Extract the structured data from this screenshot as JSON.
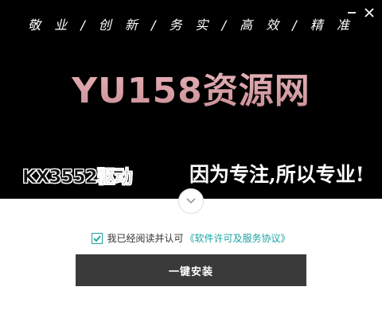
{
  "header": {
    "slogan": "敬 业 / 创 新 / 务 实 / 高 效 / 精 准",
    "minimize_icon": "minimize-icon",
    "close_icon": "close-icon"
  },
  "banner": {
    "brand": "YU158资源网",
    "product": "KX3552驱动",
    "tagline": "因为专注,所以专业!",
    "expand_icon": "chevron-down-icon"
  },
  "agreement": {
    "checked": true,
    "text": "我已经阅读并认可",
    "link": "《软件许可及服务协议》"
  },
  "actions": {
    "install_label": "一键安装"
  },
  "colors": {
    "banner_bg": "#000000",
    "accent": "#1aa3a3",
    "button_bg": "#3a3a3a",
    "brand_pink": "#d8a0a4"
  }
}
